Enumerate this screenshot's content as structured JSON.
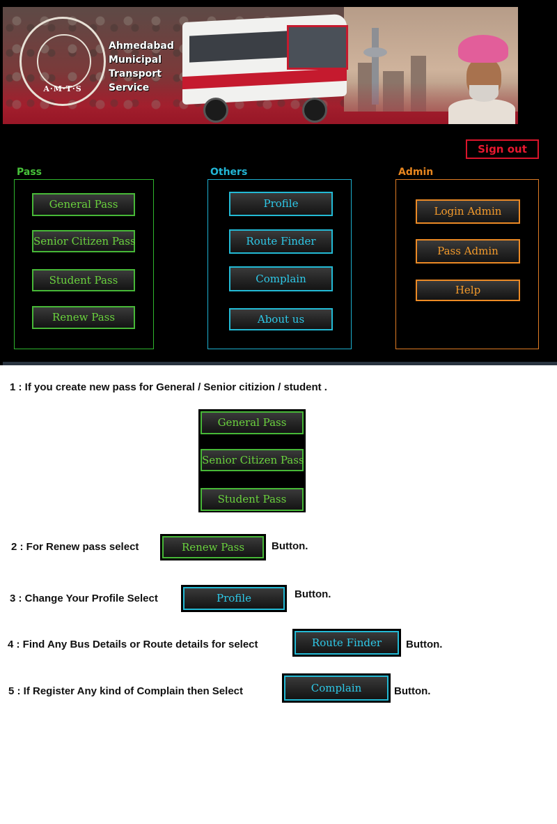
{
  "banner": {
    "org_name_lines": [
      "Ahmedabad",
      "Municipal",
      "Transport",
      "Service"
    ],
    "logo_text": "A·M·T·S"
  },
  "header": {
    "signout_label": "Sign out"
  },
  "pass_section": {
    "title": "Pass",
    "buttons": [
      "General Pass",
      "Senior Citizen Pass",
      "Student Pass",
      "Renew Pass"
    ]
  },
  "others_section": {
    "title": "Others",
    "buttons": [
      "Profile",
      "Route Finder",
      "Complain",
      "About us"
    ]
  },
  "admin_section": {
    "title": "Admin",
    "buttons": [
      "Login Admin",
      "Pass Admin",
      "Help"
    ]
  },
  "instructions": {
    "step1": "1 : If you create new pass for General / Senior citizion / student .",
    "step1_buttons": [
      "General Pass",
      "Senior Citizen Pass",
      "Student Pass"
    ],
    "step2": "2 : For Renew pass  select",
    "step2_button": "Renew Pass",
    "step3": "3 : Change Your Profile   Select",
    "step3_button": "Profile",
    "step4": "4 : Find Any Bus Details or Route details  for select",
    "step4_button": "Route Finder",
    "step5": "5 : If Register  Any kind of Complain then Select",
    "step5_button": "Complain",
    "button_suffix": "Button."
  },
  "colors": {
    "pass_green": "#6ad23e",
    "others_cyan": "#2ec9e8",
    "admin_orange": "#f39a2b",
    "signout_red": "#e8182f"
  }
}
